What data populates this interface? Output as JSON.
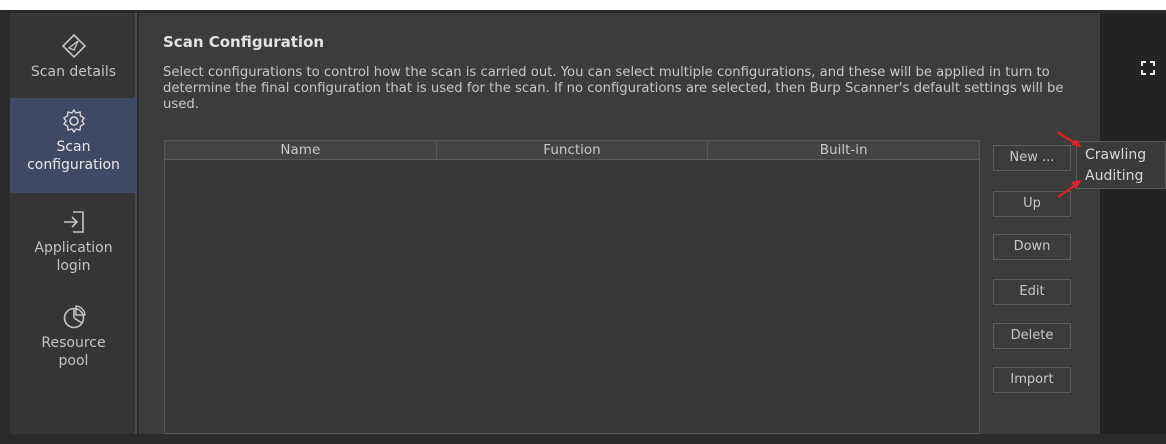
{
  "sidebar": {
    "items": [
      {
        "label": "Scan details",
        "icon": "compass-icon",
        "active": false
      },
      {
        "label": "Scan\nconfiguration",
        "icon": "gear-icon",
        "active": true
      },
      {
        "label": "Application\nlogin",
        "icon": "login-icon",
        "active": false
      },
      {
        "label": "Resource\npool",
        "icon": "pie-chart-icon",
        "active": false
      }
    ]
  },
  "main": {
    "title": "Scan Configuration",
    "description": "Select configurations to control how the scan is carried out. You can select multiple configurations, and these will be applied in turn to determine the final configuration that is used for the scan. If no configurations are selected, then Burp Scanner's default settings will be used.",
    "table": {
      "columns": [
        "Name",
        "Function",
        "Built-in"
      ],
      "rows": []
    },
    "buttons": {
      "new": "New ...",
      "up": "Up",
      "down": "Down",
      "edit": "Edit",
      "delete": "Delete",
      "import": "Import"
    }
  },
  "menu": {
    "items": [
      "Crawling",
      "Auditing"
    ]
  },
  "colors": {
    "accent_active": "#3e4a63",
    "annotation_arrow": "#e0201c"
  }
}
